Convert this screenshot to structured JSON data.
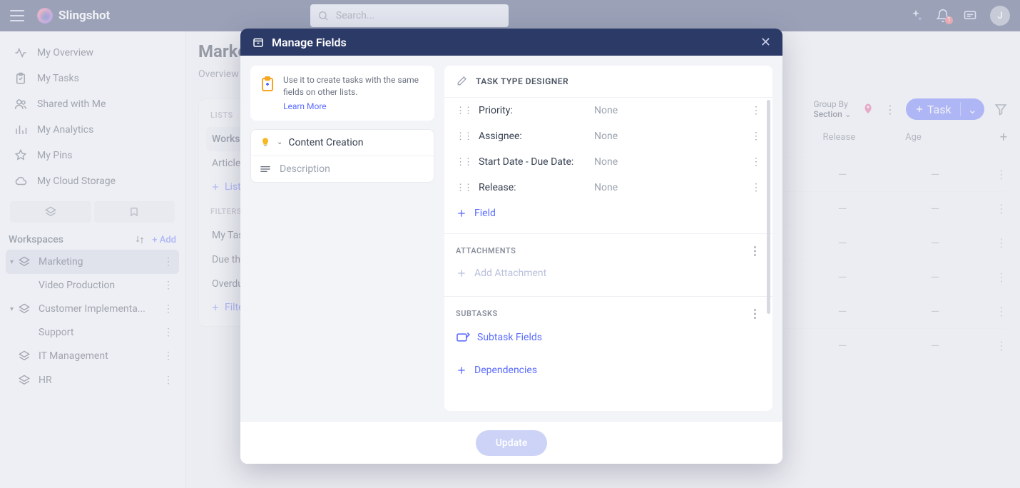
{
  "app": {
    "name": "Slingshot"
  },
  "search": {
    "placeholder": "Search..."
  },
  "notifications": {
    "count": "1"
  },
  "avatar": {
    "initial": "J"
  },
  "sidebar": {
    "items": [
      {
        "label": "My Overview"
      },
      {
        "label": "My Tasks"
      },
      {
        "label": "Shared with Me"
      },
      {
        "label": "My Analytics"
      },
      {
        "label": "My Pins"
      },
      {
        "label": "My Cloud Storage"
      }
    ]
  },
  "workspaces": {
    "heading": "Workspaces",
    "add": "Add",
    "items": [
      {
        "label": "Marketing",
        "active": true,
        "children": [
          {
            "label": "Video Production"
          }
        ]
      },
      {
        "label": "Customer Implementa...",
        "children": [
          {
            "label": "Support"
          }
        ]
      },
      {
        "label": "IT Management"
      },
      {
        "label": "HR"
      }
    ]
  },
  "page": {
    "title": "Marke",
    "tabs": [
      "Overview"
    ]
  },
  "lists": {
    "heading": "LISTS",
    "items": [
      "Workspa",
      "Articles"
    ],
    "add": "List"
  },
  "filters": {
    "heading": "FILTERS",
    "items": [
      "My Task",
      "Due this",
      "Overdue"
    ],
    "add": "Filte"
  },
  "toolbar": {
    "groupby_label": "Group By",
    "groupby_value": "Section",
    "task_button": "Task",
    "columns": [
      "Release",
      "Age"
    ]
  },
  "modal": {
    "title": "Manage Fields",
    "info_text": "Use it to create tasks with the same fields on other lists.",
    "learn_more": "Learn More",
    "task_type_name": "Content Creation",
    "description_placeholder": "Description",
    "designer_heading": "TASK TYPE DESIGNER",
    "fields": [
      {
        "label": "Priority:",
        "value": "None"
      },
      {
        "label": "Assignee:",
        "value": "None"
      },
      {
        "label": "Start Date - Due Date:",
        "value": "None"
      },
      {
        "label": "Release:",
        "value": "None"
      }
    ],
    "add_field": "Field",
    "attachments_heading": "ATTACHMENTS",
    "add_attachment": "Add Attachment",
    "subtasks_heading": "SUBTASKS",
    "subtask_fields": "Subtask Fields",
    "dependencies": "Dependencies",
    "update_button": "Update"
  }
}
